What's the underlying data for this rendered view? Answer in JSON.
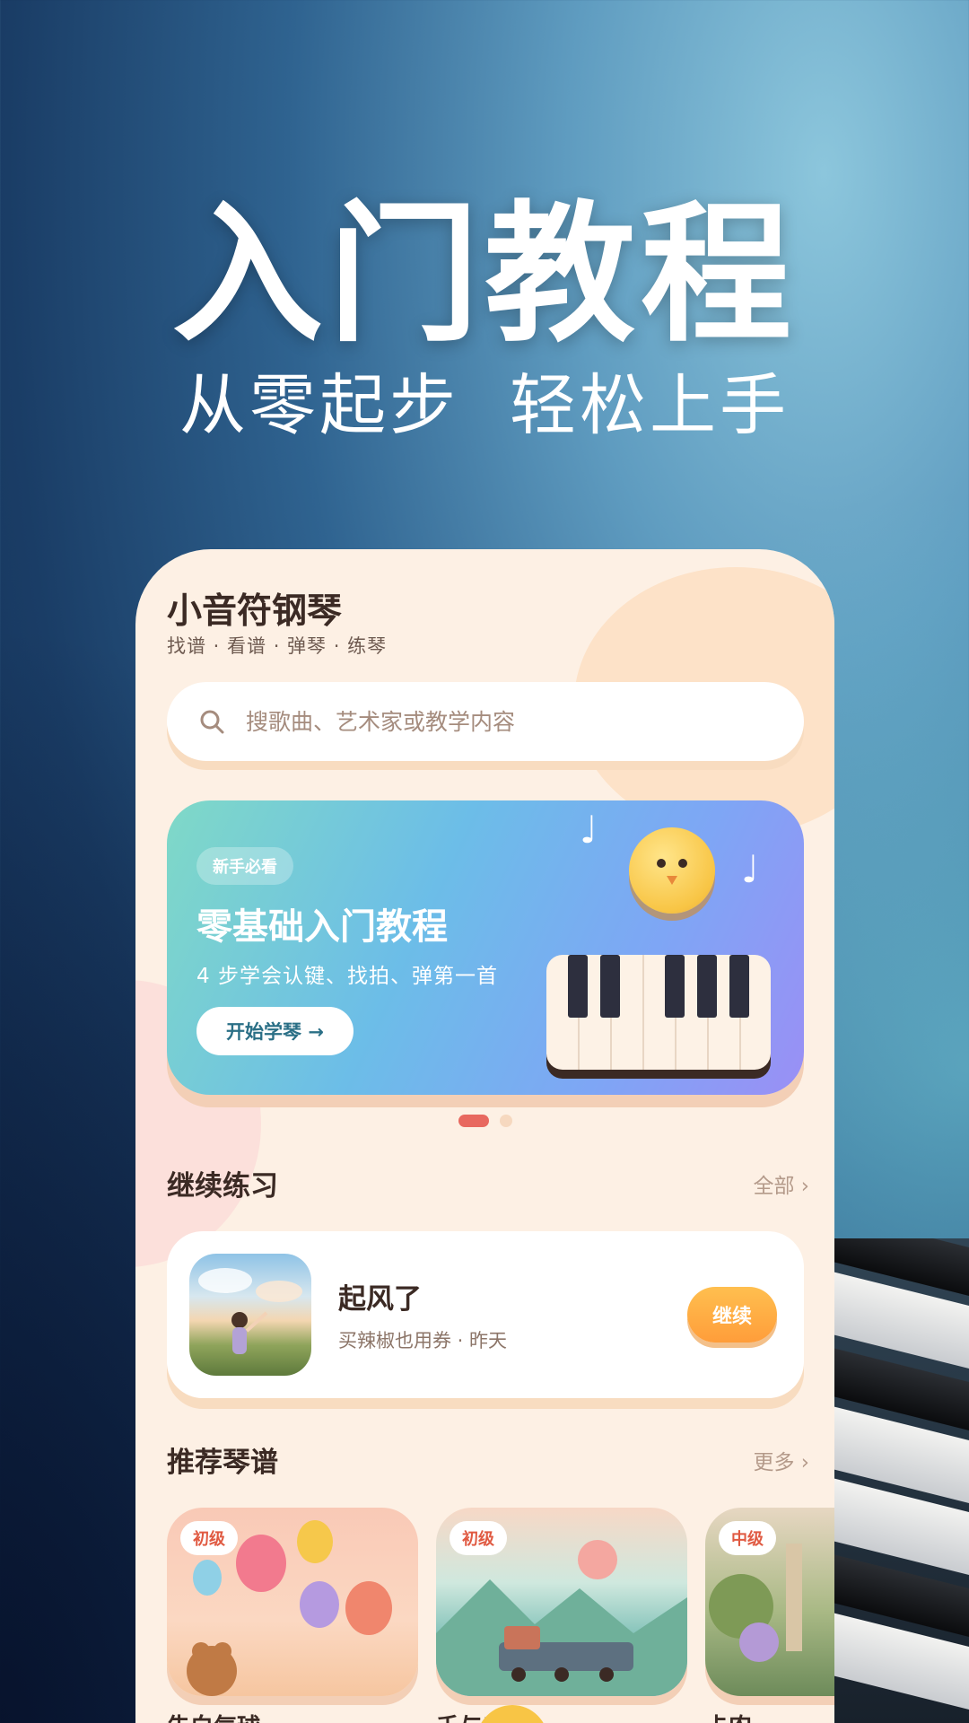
{
  "hero": {
    "title": "入门教程",
    "subtitle_left": "从零起步",
    "subtitle_right": "轻松上手"
  },
  "app": {
    "name": "小音符钢琴",
    "tagline": "找谱 · 看谱 · 弹琴 · 练琴"
  },
  "search": {
    "placeholder": "搜歌曲、艺术家或教学内容",
    "icon": "search-icon"
  },
  "banner": {
    "badge": "新手必看",
    "title": "零基础入门教程",
    "description": "4 步学会认键、找拍、弹第一首",
    "button_label": "开始学琴 →",
    "page_count": 2,
    "active_page": 1
  },
  "continue_section": {
    "title": "继续练习",
    "link": "全部 ›",
    "item": {
      "title": "起风了",
      "meta": "买辣椒也用券 · 昨天",
      "button": "继续"
    }
  },
  "recommend_section": {
    "title": "推荐琴谱",
    "link": "更多 ›",
    "items": [
      {
        "level": "初级",
        "name": "告白气球"
      },
      {
        "level": "初级",
        "name": "千与千寻"
      },
      {
        "level": "中级",
        "name": "卡农"
      }
    ]
  },
  "colors": {
    "accent": "#ff9d3a",
    "phone_bg": "#fdf0e4",
    "level_tag": "#e05a42"
  }
}
